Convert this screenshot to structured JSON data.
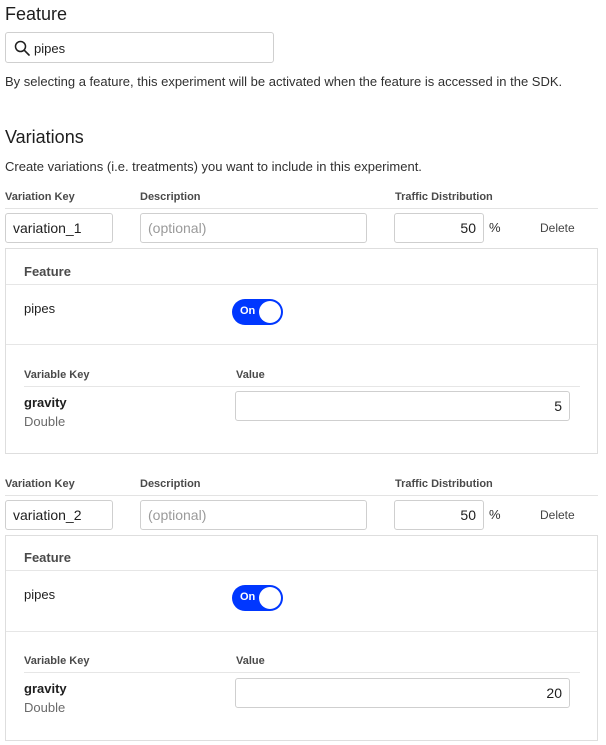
{
  "feature_section": {
    "title": "Feature",
    "search_value": "pipes",
    "help_text": "By selecting a feature, this experiment will be activated when the feature is accessed in the SDK."
  },
  "variations_section": {
    "title": "Variations",
    "help_text": "Create variations (i.e. treatments) you want to include in this experiment."
  },
  "columns": {
    "variation_key": "Variation Key",
    "description": "Description",
    "traffic": "Traffic Distribution"
  },
  "variations": [
    {
      "key": "variation_1",
      "description_placeholder": "(optional)",
      "traffic": "50",
      "percent": "%",
      "delete_label": "Delete",
      "feature_header": "Feature",
      "feature_name": "pipes",
      "toggle_label": "On",
      "variable_key_header": "Variable Key",
      "value_header": "Value",
      "variable_name": "gravity",
      "variable_type": "Double",
      "variable_value": "5"
    },
    {
      "key": "variation_2",
      "description_placeholder": "(optional)",
      "traffic": "50",
      "percent": "%",
      "delete_label": "Delete",
      "feature_header": "Feature",
      "feature_name": "pipes",
      "toggle_label": "On",
      "variable_key_header": "Variable Key",
      "value_header": "Value",
      "variable_name": "gravity",
      "variable_type": "Double",
      "variable_value": "20"
    }
  ],
  "colors": {
    "toggle_on": "#0037ff",
    "border": "#cfcfcf"
  },
  "icons": {
    "search": "search-icon"
  }
}
